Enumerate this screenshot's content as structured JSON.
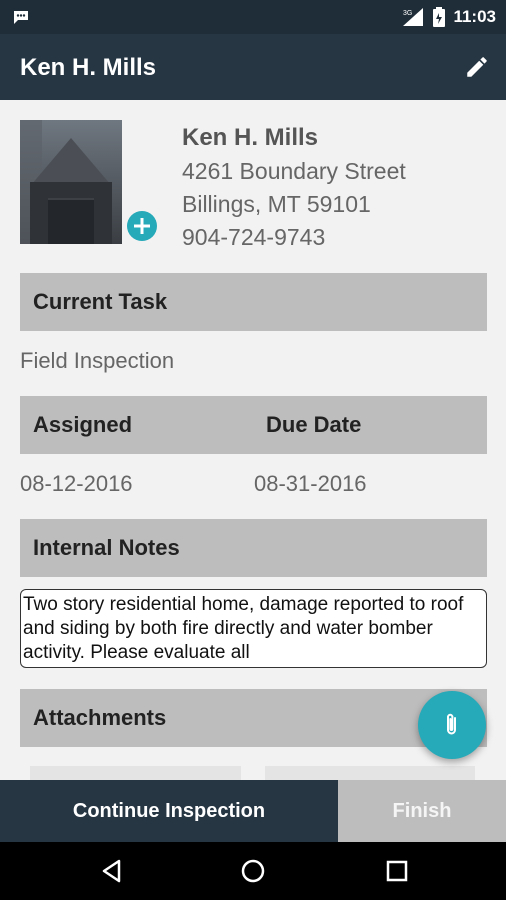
{
  "status_bar": {
    "time": "11:03",
    "network": "3G"
  },
  "app_bar": {
    "title": "Ken H. Mills"
  },
  "contact": {
    "name": "Ken H. Mills",
    "address_line1": "4261 Boundary Street",
    "address_line2": "Billings, MT 59101",
    "phone": "904-724-9743"
  },
  "current_task": {
    "header": "Current Task",
    "value": "Field Inspection"
  },
  "dates": {
    "assigned_label": "Assigned",
    "due_label": "Due Date",
    "assigned_value": "08-12-2016",
    "due_value": "08-31-2016"
  },
  "notes": {
    "header": "Internal Notes",
    "text": "Two story residential home, damage reported to roof and siding by both fire directly and water bomber activity.  Please evaluate all"
  },
  "attachments": {
    "header": "Attachments"
  },
  "actions": {
    "continue_label": "Continue Inspection",
    "finish_label": "Finish"
  },
  "colors": {
    "app_bar": "#263643",
    "accent": "#26a9b8",
    "section_header": "#bdbdbd"
  },
  "icons": [
    "message-icon",
    "signal-icon",
    "battery-icon",
    "edit-icon",
    "add-photo-icon",
    "attachment-icon",
    "back-icon",
    "home-icon",
    "recents-icon"
  ]
}
